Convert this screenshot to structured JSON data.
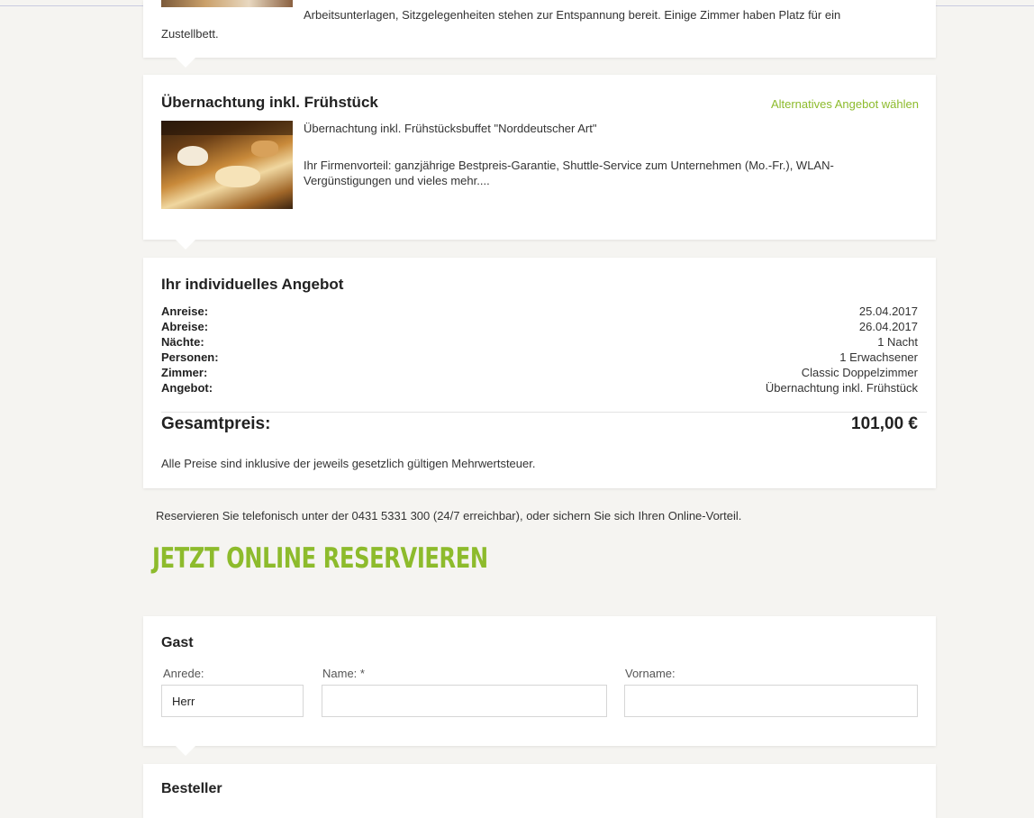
{
  "room": {
    "desc_line1": "Arbeitsunterlagen, Sitzgelegenheiten stehen zur Entspannung bereit. Einige Zimmer haben Platz für ein",
    "desc_line2": "Zustellbett."
  },
  "offer": {
    "title": "Übernachtung inkl. Frühstück",
    "alt_link": "Alternatives Angebot wählen",
    "line1": "Übernachtung inkl. Frühstücksbuffet \"Norddeutscher Art\"",
    "line2": "Ihr Firmenvorteil: ganzjährige Bestpreis-Garantie, Shuttle-Service zum Unternehmen (Mo.-Fr.), WLAN-Vergünstigungen und vieles mehr...."
  },
  "summary": {
    "title": "Ihr individuelles Angebot",
    "rows": [
      {
        "label": "Anreise:",
        "value": "25.04.2017"
      },
      {
        "label": "Abreise:",
        "value": "26.04.2017"
      },
      {
        "label": "Nächte:",
        "value": "1 Nacht"
      },
      {
        "label": "Personen:",
        "value": "1 Erwachsener"
      },
      {
        "label": "Zimmer:",
        "value": "Classic Doppelzimmer"
      },
      {
        "label": "Angebot:",
        "value": "Übernachtung inkl. Frühstück"
      }
    ],
    "total_label": "Gesamtpreis:",
    "total_value": "101,00 €",
    "vat_note": "Alle Preise sind inklusive der jeweils gesetzlich gültigen Mehrwertsteuer."
  },
  "phone_note": "Reservieren Sie telefonisch unter der 0431 5331 300 (24/7 erreichbar), oder sichern Sie sich Ihren Online-Vorteil.",
  "cta": "JETZT ONLINE RESERVIEREN",
  "guest": {
    "title": "Gast",
    "salutation_label": "Anrede:",
    "salutation_value": "Herr",
    "name_label": "Name: *",
    "name_value": "",
    "firstname_label": "Vorname:",
    "firstname_value": ""
  },
  "orderer": {
    "title": "Besteller"
  },
  "colors": {
    "accent_green": "#8dbb2c",
    "page_background": "#f5f4f1"
  }
}
